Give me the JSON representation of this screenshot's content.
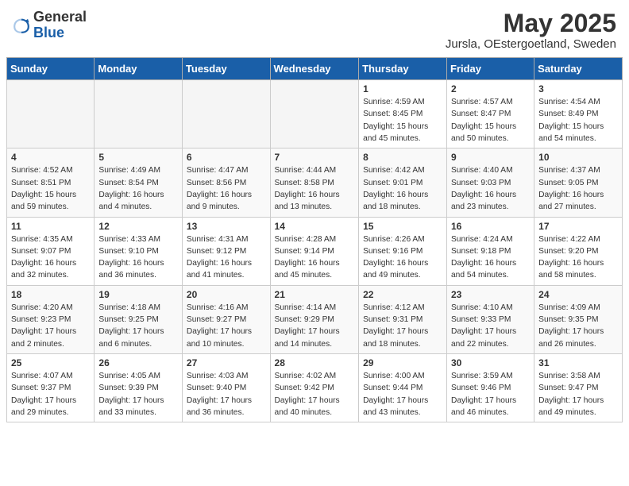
{
  "header": {
    "logo_general": "General",
    "logo_blue": "Blue",
    "title": "May 2025",
    "location": "Jursla, OEstergoetland, Sweden"
  },
  "days_of_week": [
    "Sunday",
    "Monday",
    "Tuesday",
    "Wednesday",
    "Thursday",
    "Friday",
    "Saturday"
  ],
  "weeks": [
    [
      {
        "day": "",
        "info": ""
      },
      {
        "day": "",
        "info": ""
      },
      {
        "day": "",
        "info": ""
      },
      {
        "day": "",
        "info": ""
      },
      {
        "day": "1",
        "info": "Sunrise: 4:59 AM\nSunset: 8:45 PM\nDaylight: 15 hours\nand 45 minutes."
      },
      {
        "day": "2",
        "info": "Sunrise: 4:57 AM\nSunset: 8:47 PM\nDaylight: 15 hours\nand 50 minutes."
      },
      {
        "day": "3",
        "info": "Sunrise: 4:54 AM\nSunset: 8:49 PM\nDaylight: 15 hours\nand 54 minutes."
      }
    ],
    [
      {
        "day": "4",
        "info": "Sunrise: 4:52 AM\nSunset: 8:51 PM\nDaylight: 15 hours\nand 59 minutes."
      },
      {
        "day": "5",
        "info": "Sunrise: 4:49 AM\nSunset: 8:54 PM\nDaylight: 16 hours\nand 4 minutes."
      },
      {
        "day": "6",
        "info": "Sunrise: 4:47 AM\nSunset: 8:56 PM\nDaylight: 16 hours\nand 9 minutes."
      },
      {
        "day": "7",
        "info": "Sunrise: 4:44 AM\nSunset: 8:58 PM\nDaylight: 16 hours\nand 13 minutes."
      },
      {
        "day": "8",
        "info": "Sunrise: 4:42 AM\nSunset: 9:01 PM\nDaylight: 16 hours\nand 18 minutes."
      },
      {
        "day": "9",
        "info": "Sunrise: 4:40 AM\nSunset: 9:03 PM\nDaylight: 16 hours\nand 23 minutes."
      },
      {
        "day": "10",
        "info": "Sunrise: 4:37 AM\nSunset: 9:05 PM\nDaylight: 16 hours\nand 27 minutes."
      }
    ],
    [
      {
        "day": "11",
        "info": "Sunrise: 4:35 AM\nSunset: 9:07 PM\nDaylight: 16 hours\nand 32 minutes."
      },
      {
        "day": "12",
        "info": "Sunrise: 4:33 AM\nSunset: 9:10 PM\nDaylight: 16 hours\nand 36 minutes."
      },
      {
        "day": "13",
        "info": "Sunrise: 4:31 AM\nSunset: 9:12 PM\nDaylight: 16 hours\nand 41 minutes."
      },
      {
        "day": "14",
        "info": "Sunrise: 4:28 AM\nSunset: 9:14 PM\nDaylight: 16 hours\nand 45 minutes."
      },
      {
        "day": "15",
        "info": "Sunrise: 4:26 AM\nSunset: 9:16 PM\nDaylight: 16 hours\nand 49 minutes."
      },
      {
        "day": "16",
        "info": "Sunrise: 4:24 AM\nSunset: 9:18 PM\nDaylight: 16 hours\nand 54 minutes."
      },
      {
        "day": "17",
        "info": "Sunrise: 4:22 AM\nSunset: 9:20 PM\nDaylight: 16 hours\nand 58 minutes."
      }
    ],
    [
      {
        "day": "18",
        "info": "Sunrise: 4:20 AM\nSunset: 9:23 PM\nDaylight: 17 hours\nand 2 minutes."
      },
      {
        "day": "19",
        "info": "Sunrise: 4:18 AM\nSunset: 9:25 PM\nDaylight: 17 hours\nand 6 minutes."
      },
      {
        "day": "20",
        "info": "Sunrise: 4:16 AM\nSunset: 9:27 PM\nDaylight: 17 hours\nand 10 minutes."
      },
      {
        "day": "21",
        "info": "Sunrise: 4:14 AM\nSunset: 9:29 PM\nDaylight: 17 hours\nand 14 minutes."
      },
      {
        "day": "22",
        "info": "Sunrise: 4:12 AM\nSunset: 9:31 PM\nDaylight: 17 hours\nand 18 minutes."
      },
      {
        "day": "23",
        "info": "Sunrise: 4:10 AM\nSunset: 9:33 PM\nDaylight: 17 hours\nand 22 minutes."
      },
      {
        "day": "24",
        "info": "Sunrise: 4:09 AM\nSunset: 9:35 PM\nDaylight: 17 hours\nand 26 minutes."
      }
    ],
    [
      {
        "day": "25",
        "info": "Sunrise: 4:07 AM\nSunset: 9:37 PM\nDaylight: 17 hours\nand 29 minutes."
      },
      {
        "day": "26",
        "info": "Sunrise: 4:05 AM\nSunset: 9:39 PM\nDaylight: 17 hours\nand 33 minutes."
      },
      {
        "day": "27",
        "info": "Sunrise: 4:03 AM\nSunset: 9:40 PM\nDaylight: 17 hours\nand 36 minutes."
      },
      {
        "day": "28",
        "info": "Sunrise: 4:02 AM\nSunset: 9:42 PM\nDaylight: 17 hours\nand 40 minutes."
      },
      {
        "day": "29",
        "info": "Sunrise: 4:00 AM\nSunset: 9:44 PM\nDaylight: 17 hours\nand 43 minutes."
      },
      {
        "day": "30",
        "info": "Sunrise: 3:59 AM\nSunset: 9:46 PM\nDaylight: 17 hours\nand 46 minutes."
      },
      {
        "day": "31",
        "info": "Sunrise: 3:58 AM\nSunset: 9:47 PM\nDaylight: 17 hours\nand 49 minutes."
      }
    ]
  ]
}
